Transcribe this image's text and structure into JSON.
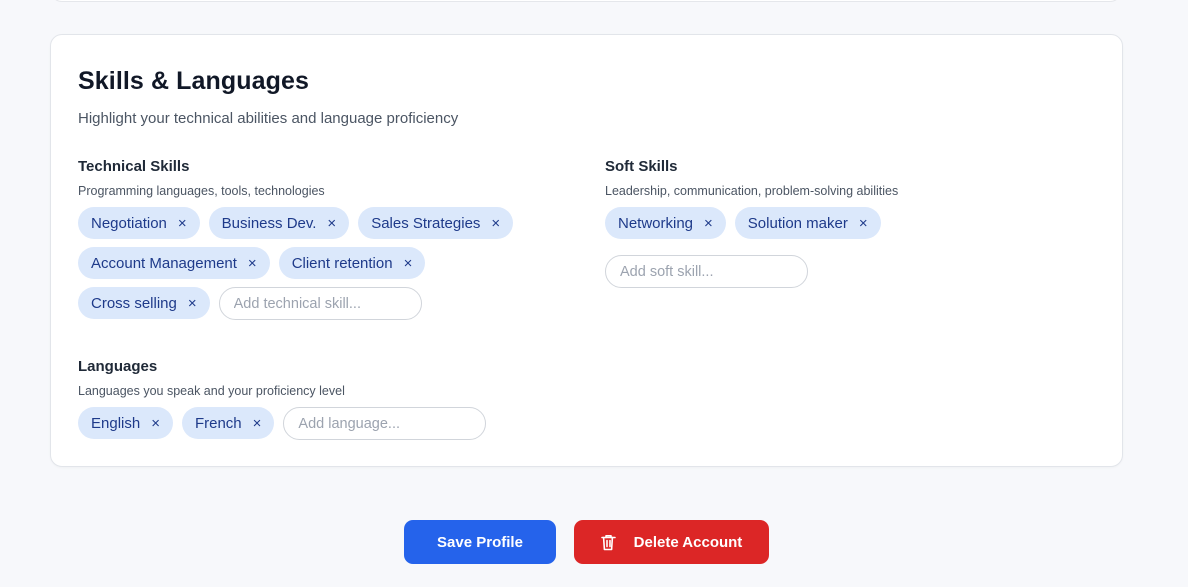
{
  "skills_card": {
    "title": "Skills & Languages",
    "subtitle": "Highlight your technical abilities and language proficiency",
    "technical": {
      "label": "Technical Skills",
      "hint": "Programming languages, tools, technologies",
      "chips": [
        "Negotiation",
        "Business Dev.",
        "Sales Strategies",
        "Account Management",
        "Client retention",
        "Cross selling"
      ],
      "placeholder": "Add technical skill..."
    },
    "soft": {
      "label": "Soft Skills",
      "hint": "Leadership, communication, problem-solving abilities",
      "chips": [
        "Networking",
        "Solution maker"
      ],
      "placeholder": "Add soft skill..."
    },
    "languages": {
      "label": "Languages",
      "hint": "Languages you speak and your proficiency level",
      "chips": [
        "English",
        "French"
      ],
      "placeholder": "Add language..."
    },
    "remove_glyph": "×"
  },
  "actions": {
    "save_label": "Save Profile",
    "delete_label": "Delete Account",
    "delete_icon": "trash-icon"
  },
  "colors": {
    "chip_bg": "#dbe8fb",
    "chip_text": "#1e3a8a",
    "primary": "#2563eb",
    "danger": "#dc2626"
  }
}
